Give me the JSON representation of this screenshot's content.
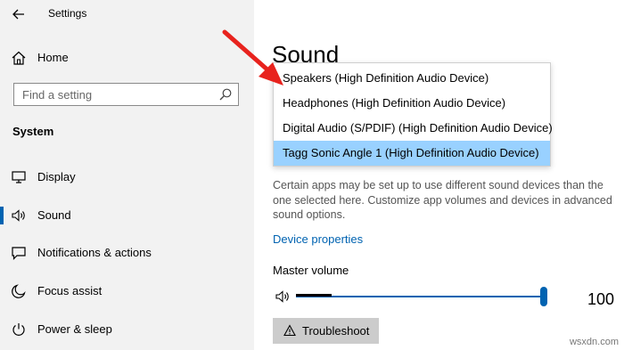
{
  "window": {
    "title": "Settings"
  },
  "sidebar": {
    "home_label": "Home",
    "search_placeholder": "Find a setting",
    "section_heading": "System",
    "items": [
      {
        "label": "Display",
        "icon": "monitor-icon",
        "selected": false
      },
      {
        "label": "Sound",
        "icon": "speaker-icon",
        "selected": true
      },
      {
        "label": "Notifications & actions",
        "icon": "chat-bubble-icon",
        "selected": false
      },
      {
        "label": "Focus assist",
        "icon": "moon-icon",
        "selected": false
      },
      {
        "label": "Power & sleep",
        "icon": "power-icon",
        "selected": false
      }
    ]
  },
  "main": {
    "title": "Sound",
    "output_dropdown": {
      "options": [
        "Speakers (High Definition Audio Device)",
        "Headphones (High Definition Audio Device)",
        "Digital Audio (S/PDIF) (High Definition Audio Device)",
        "Tagg Sonic Angle 1 (High Definition Audio Device)"
      ],
      "selected_index": 3
    },
    "description": "Certain apps may be set up to use different sound devices than the one selected here. Customize app volumes and devices in advanced sound options.",
    "device_properties_link": "Device properties",
    "master_volume_label": "Master volume",
    "master_volume_value": "100",
    "troubleshoot_label": "Troubleshoot"
  },
  "watermark": "wsxdn.com",
  "colors": {
    "accent": "#0063b1",
    "selection_highlight": "#99d1ff",
    "sidebar_bg": "#f2f2f2",
    "annotation_arrow": "#e8231e"
  }
}
